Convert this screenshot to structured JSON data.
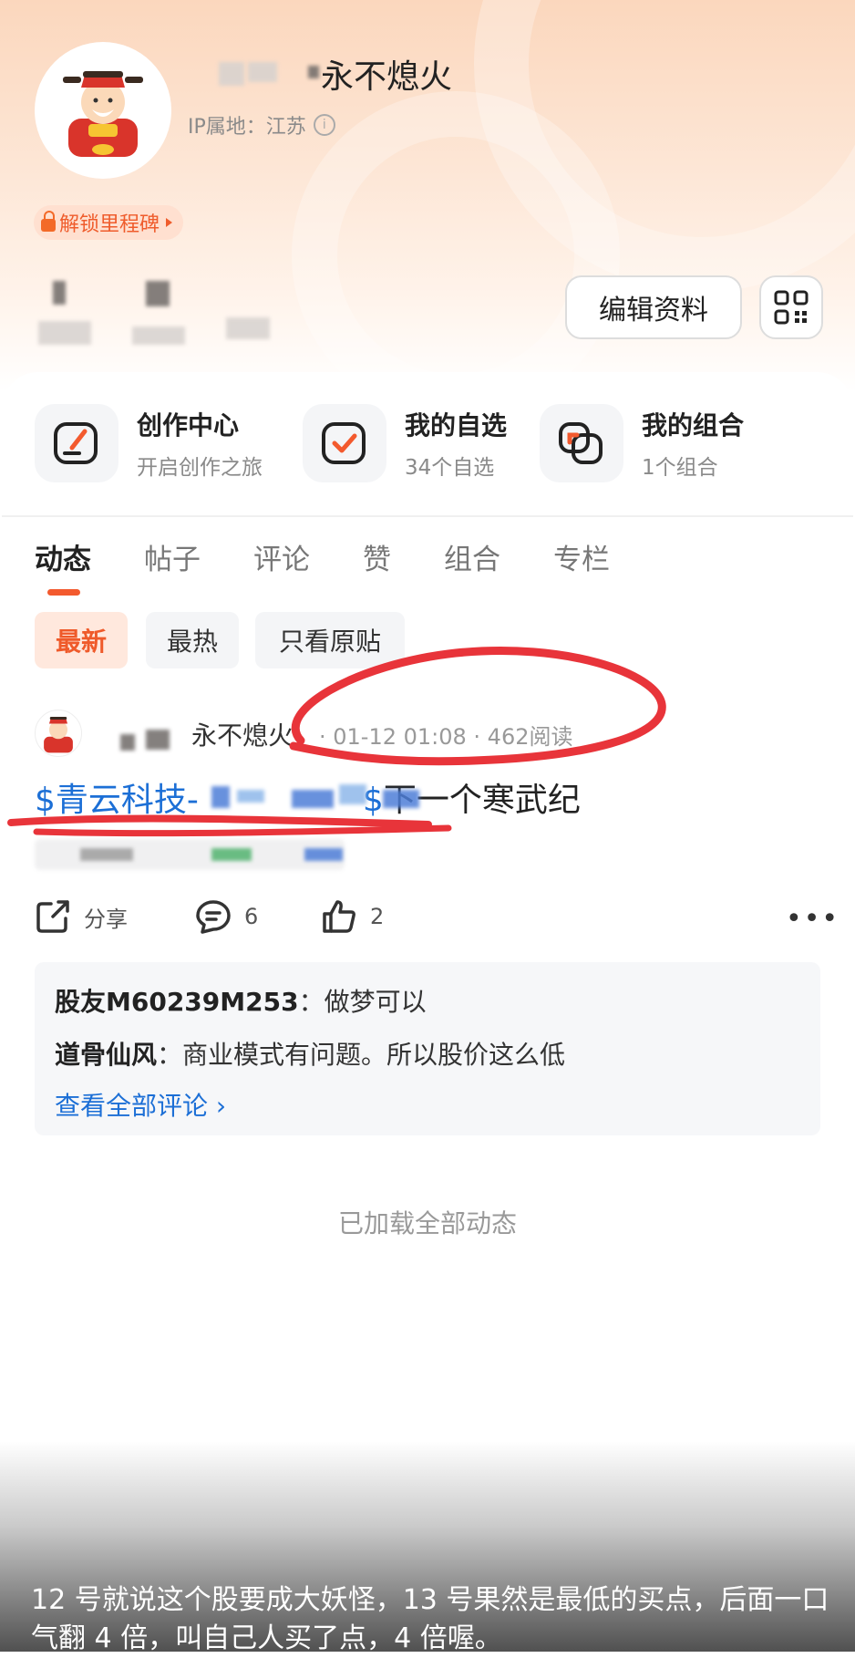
{
  "profile": {
    "username": "永不熄火",
    "ip_location": "IP属地：江苏",
    "milestone_label": "解锁里程碑",
    "edit_button": "编辑资料"
  },
  "tools": [
    {
      "title": "创作中心",
      "subtitle": "开启创作之旅"
    },
    {
      "title": "我的自选",
      "subtitle": "34个自选"
    },
    {
      "title": "我的组合",
      "subtitle": "1个组合"
    }
  ],
  "tabs": [
    "动态",
    "帖子",
    "评论",
    "赞",
    "组合",
    "专栏"
  ],
  "filters": [
    "最新",
    "最热",
    "只看原贴"
  ],
  "post": {
    "author": "永不熄火",
    "meta": "· 01-12 01:08 · 462阅读",
    "stock_prefix": "$青云科技-",
    "stock_suffix": "$",
    "title_rest": "下一个寒武纪",
    "share_label": "分享",
    "comment_count": "6",
    "like_count": "2"
  },
  "comments": [
    {
      "author": "股友M60239M253",
      "text": "：做梦可以"
    },
    {
      "author": "道骨仙风",
      "text": "：商业模式有问题。所以股价这么低"
    }
  ],
  "view_all_comments": "查看全部评论 ›",
  "loaded_all": "已加载全部动态",
  "caption": "12 号就说这个股要成大妖怪，13 号果然是最低的买点，后面一口气翻 4 倍，叫自己人买了点，4 倍喔。",
  "colors": {
    "accent": "#f35a2e",
    "link": "#1c6fd6",
    "annotation": "#e8343a"
  },
  "icons": [
    "info-icon",
    "lock-icon",
    "qr-code-icon",
    "create-icon",
    "watchlist-icon",
    "portfolio-icon",
    "share-icon",
    "comment-icon",
    "like-icon",
    "more-icon"
  ]
}
